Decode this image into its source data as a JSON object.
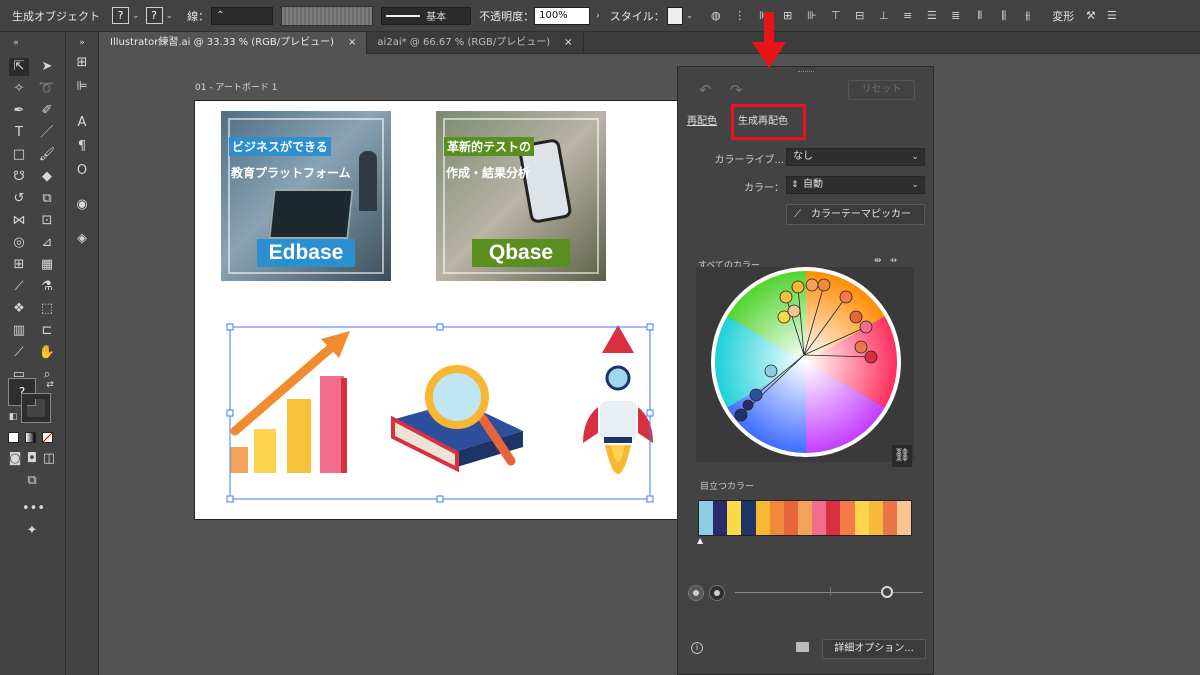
{
  "control_bar": {
    "title": "生成オブジェクト",
    "fill_q": "?",
    "stroke_q": "?",
    "stroke_label": "線：",
    "brush_label": "基本",
    "opacity_label": "不透明度：",
    "opacity_value": "100%",
    "style_label": "スタイル：",
    "transform_label": "変形"
  },
  "tabs": [
    {
      "label": "Illustrator練習.ai @ 33.33 % (RGB/プレビュー)",
      "close": "×"
    },
    {
      "label": "ai2ai* @ 66.67 % (RGB/プレビュー)",
      "close": "×"
    }
  ],
  "artboard": {
    "label": "01 - アートボード 1",
    "cards": [
      {
        "line1": "ビジネスができる",
        "line2": "教育プラットフォーム",
        "brand": "Edbase",
        "accent": "#2b8fd0"
      },
      {
        "line1": "革新的テストの",
        "line2": "作成・結果分析",
        "brand": "Qbase",
        "accent": "#5a8f1f"
      }
    ]
  },
  "panel": {
    "reset_label": "リセット",
    "tab_recolor": "再配色",
    "tab_generative": "生成再配色",
    "library_label": "カラーライブ...",
    "library_value": "なし",
    "color_label": "カラー：",
    "color_value": "自動",
    "picker_label": "カラーテーマピッカー",
    "all_colors_label": "すべてのカラー",
    "prominent_label": "目立つカラー",
    "advanced_label": "詳細オプション...",
    "prominent_colors": [
      "#8ecde6",
      "#2b2b6b",
      "#fbd94a",
      "#1d3566",
      "#f7b733",
      "#f08a3a",
      "#e8643a",
      "#f4a259",
      "#f06d8b",
      "#d8303f",
      "#f47a47",
      "#fdd24d",
      "#f6b93c",
      "#e9774a",
      "#fbc38f"
    ]
  }
}
